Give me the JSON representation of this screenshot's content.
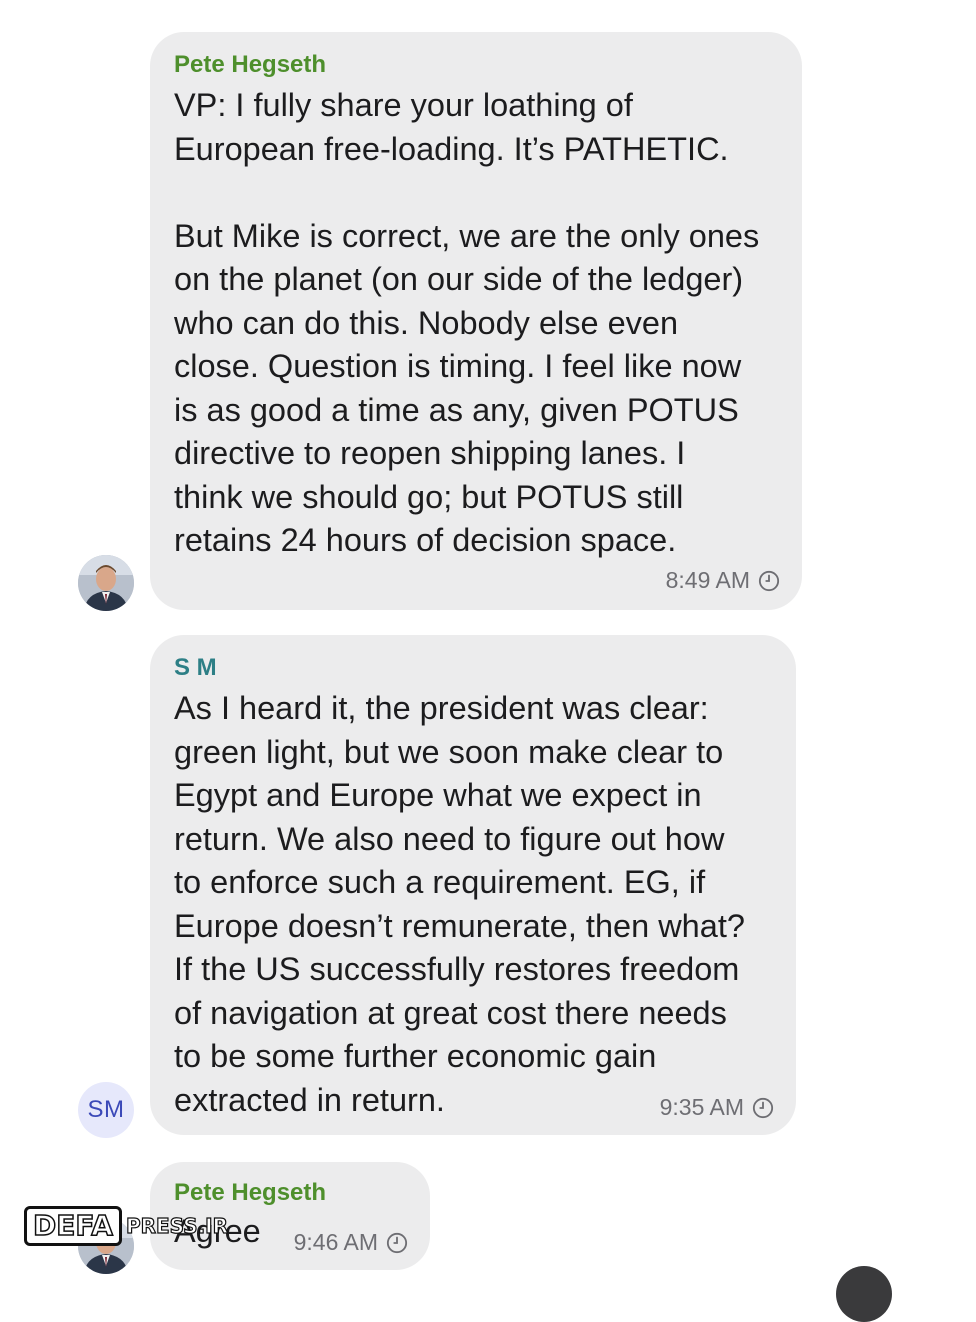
{
  "messages": [
    {
      "sender": "Pete Hegseth",
      "text": "VP: I fully share your loathing of\nEuropean free-loading. It’s PATHETIC.\n\nBut Mike is correct, we are the only ones\non the planet (on our side of the ledger)\nwho can do this. Nobody else even\nclose. Question is timing. I feel like now\nis as good a time as any, given POTUS\ndirective to reopen shipping lanes. I\nthink we should go; but POTUS still\nretains 24 hours of decision space.",
      "time": "8:49 AM",
      "avatar_type": "photo",
      "sender_color": "#4e8f2c"
    },
    {
      "sender": "S M",
      "text": "As I heard it, the president was clear:\ngreen light, but we soon make clear to\nEgypt and Europe what we expect in\nreturn. We also need to figure out how\nto enforce such a requirement. EG, if\nEurope doesn’t remunerate, then what?\nIf the US successfully restores freedom\nof navigation at great cost there needs\nto be some further economic gain\nextracted in return.",
      "time": "9:35 AM",
      "avatar_type": "initials",
      "avatar_initials": "SM",
      "sender_color": "#2d7f86"
    },
    {
      "sender": "Pete Hegseth",
      "text": "Agree",
      "time": "9:46 AM",
      "avatar_type": "photo",
      "sender_color": "#4e8f2c"
    }
  ],
  "watermark": {
    "logo": "DEFA",
    "site": "PRESS.IR"
  },
  "icons": {
    "timestamp": "clock-icon"
  },
  "colors": {
    "bubble": "#ececed",
    "timestamp": "#6e6e73"
  }
}
